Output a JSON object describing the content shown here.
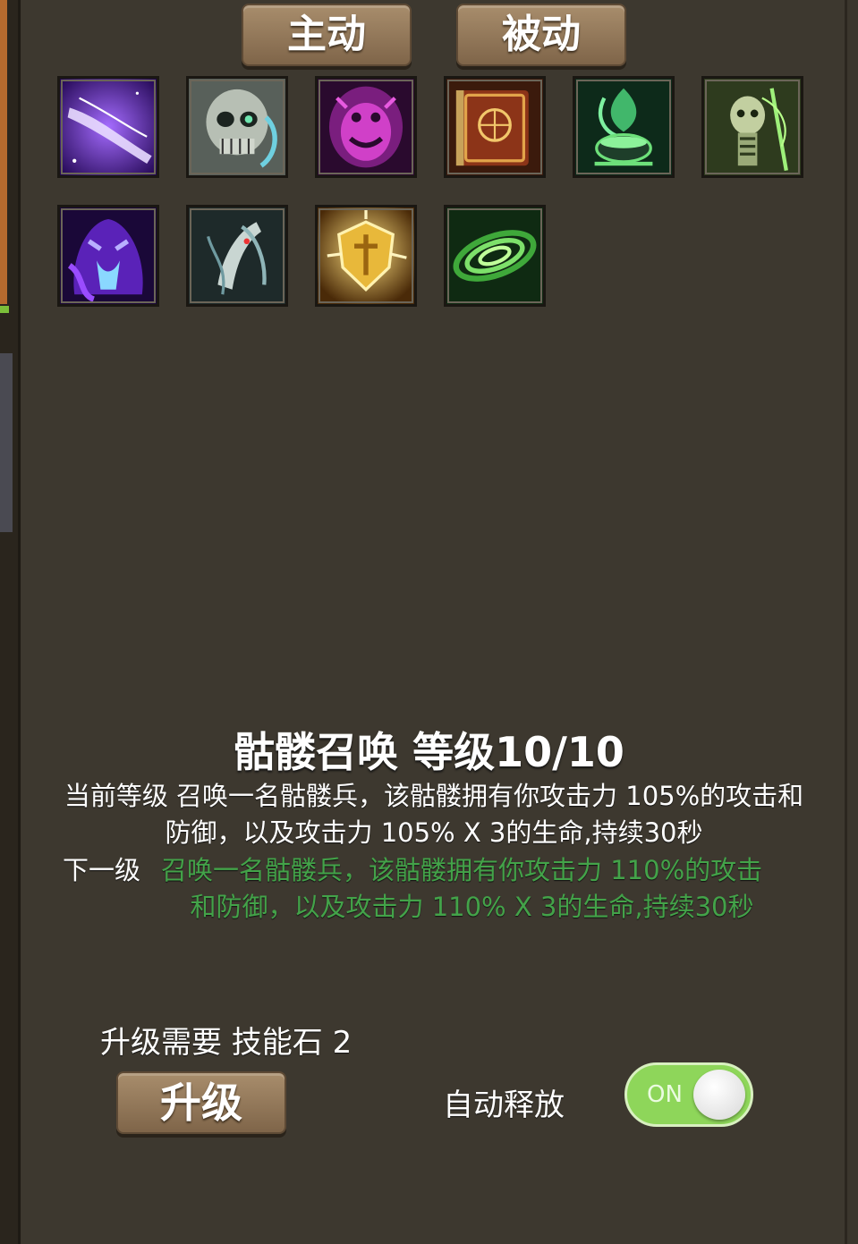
{
  "tabs": {
    "active": "主动",
    "passive": "被动"
  },
  "skills": [
    {
      "icon": "purple-lightning-icon"
    },
    {
      "icon": "skull-head-icon"
    },
    {
      "icon": "purple-demon-icon"
    },
    {
      "icon": "spellbook-icon"
    },
    {
      "icon": "green-cauldron-icon"
    },
    {
      "icon": "green-skeleton-icon"
    },
    {
      "icon": "shadow-wraith-icon"
    },
    {
      "icon": "bone-dragon-icon"
    },
    {
      "icon": "golden-shield-icon"
    },
    {
      "icon": "green-vortex-icon"
    }
  ],
  "detail": {
    "title": "骷髅召唤 等级10/10",
    "current": "当前等级 召唤一名骷髅兵，该骷髅拥有你攻击力 105%的攻击和防御，以及攻击力 105% X 3的生命,持续30秒",
    "next_label": "下一级",
    "next_line1": "召唤一名骷髅兵，该骷髅拥有你攻击力 110%的攻击",
    "next_line2": "和防御，以及攻击力 110% X 3的生命,持续30秒"
  },
  "upgrade": {
    "cost": "升级需要 技能石 2",
    "button": "升级"
  },
  "auto": {
    "label": "自动释放",
    "toggle_text": "ON",
    "enabled": true
  },
  "colors": {
    "next_level_text": "#43a349",
    "toggle_on": "#8ed65a",
    "button": "#8f7556"
  }
}
